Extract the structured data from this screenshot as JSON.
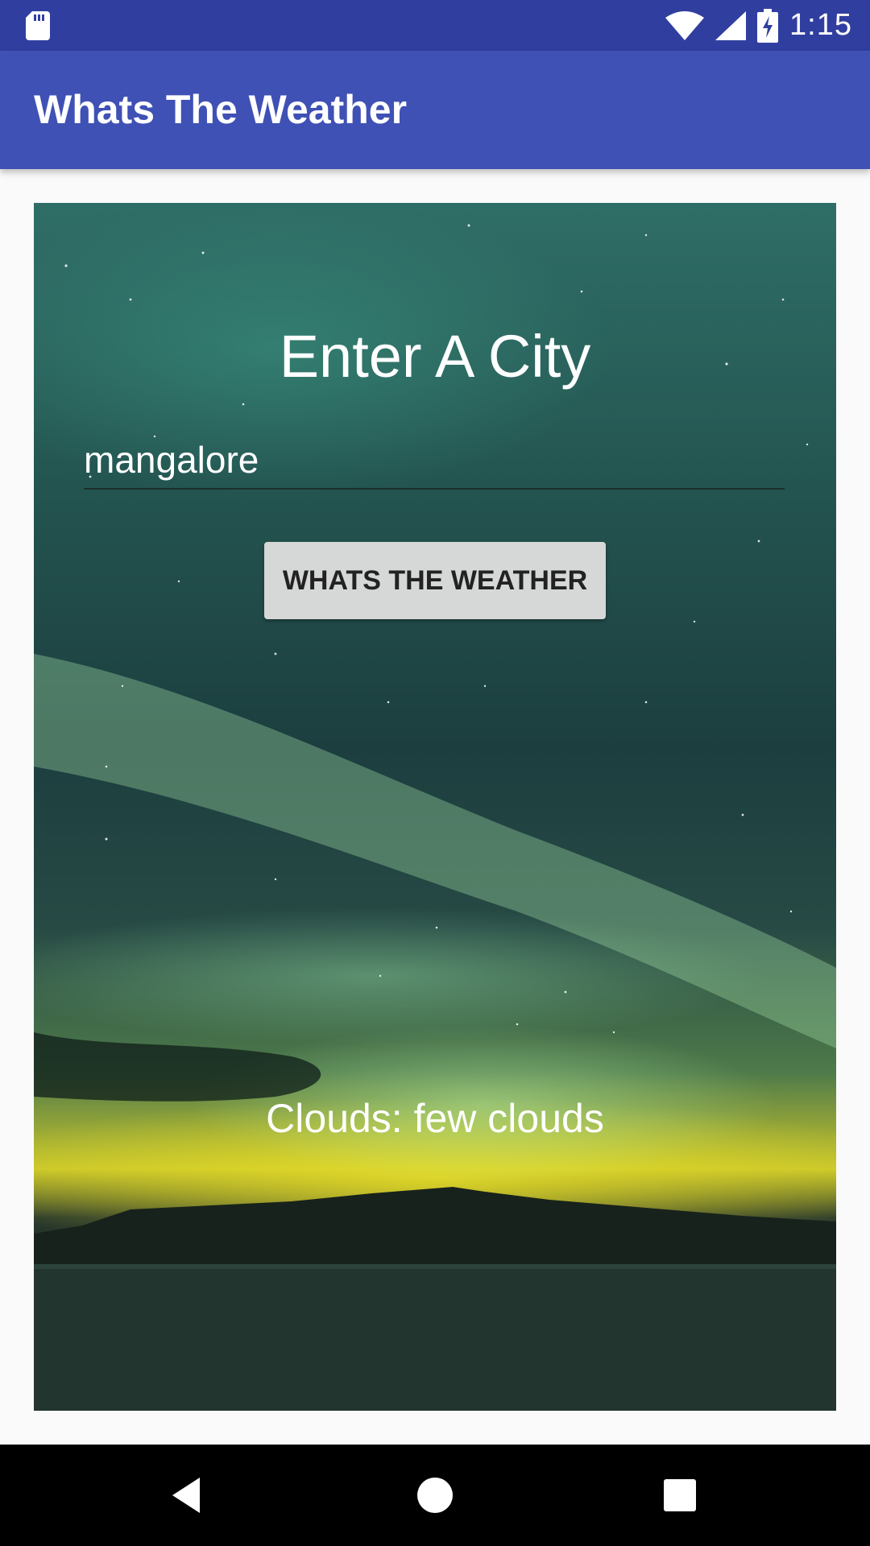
{
  "status_bar": {
    "time": "1:15",
    "icons": [
      "sd-card-icon",
      "wifi-icon",
      "cell-signal-icon",
      "battery-charging-icon"
    ]
  },
  "app_bar": {
    "title": "Whats The Weather",
    "color": "#3f51b5"
  },
  "main": {
    "heading": "Enter A City",
    "city_input": {
      "value": "mangalore"
    },
    "button_label": "WHATS THE WEATHER",
    "result": "Clouds: few clouds",
    "background": "aurora-landscape-image"
  },
  "nav_bar": {
    "icons": [
      "back-icon",
      "home-icon",
      "recents-icon"
    ]
  }
}
